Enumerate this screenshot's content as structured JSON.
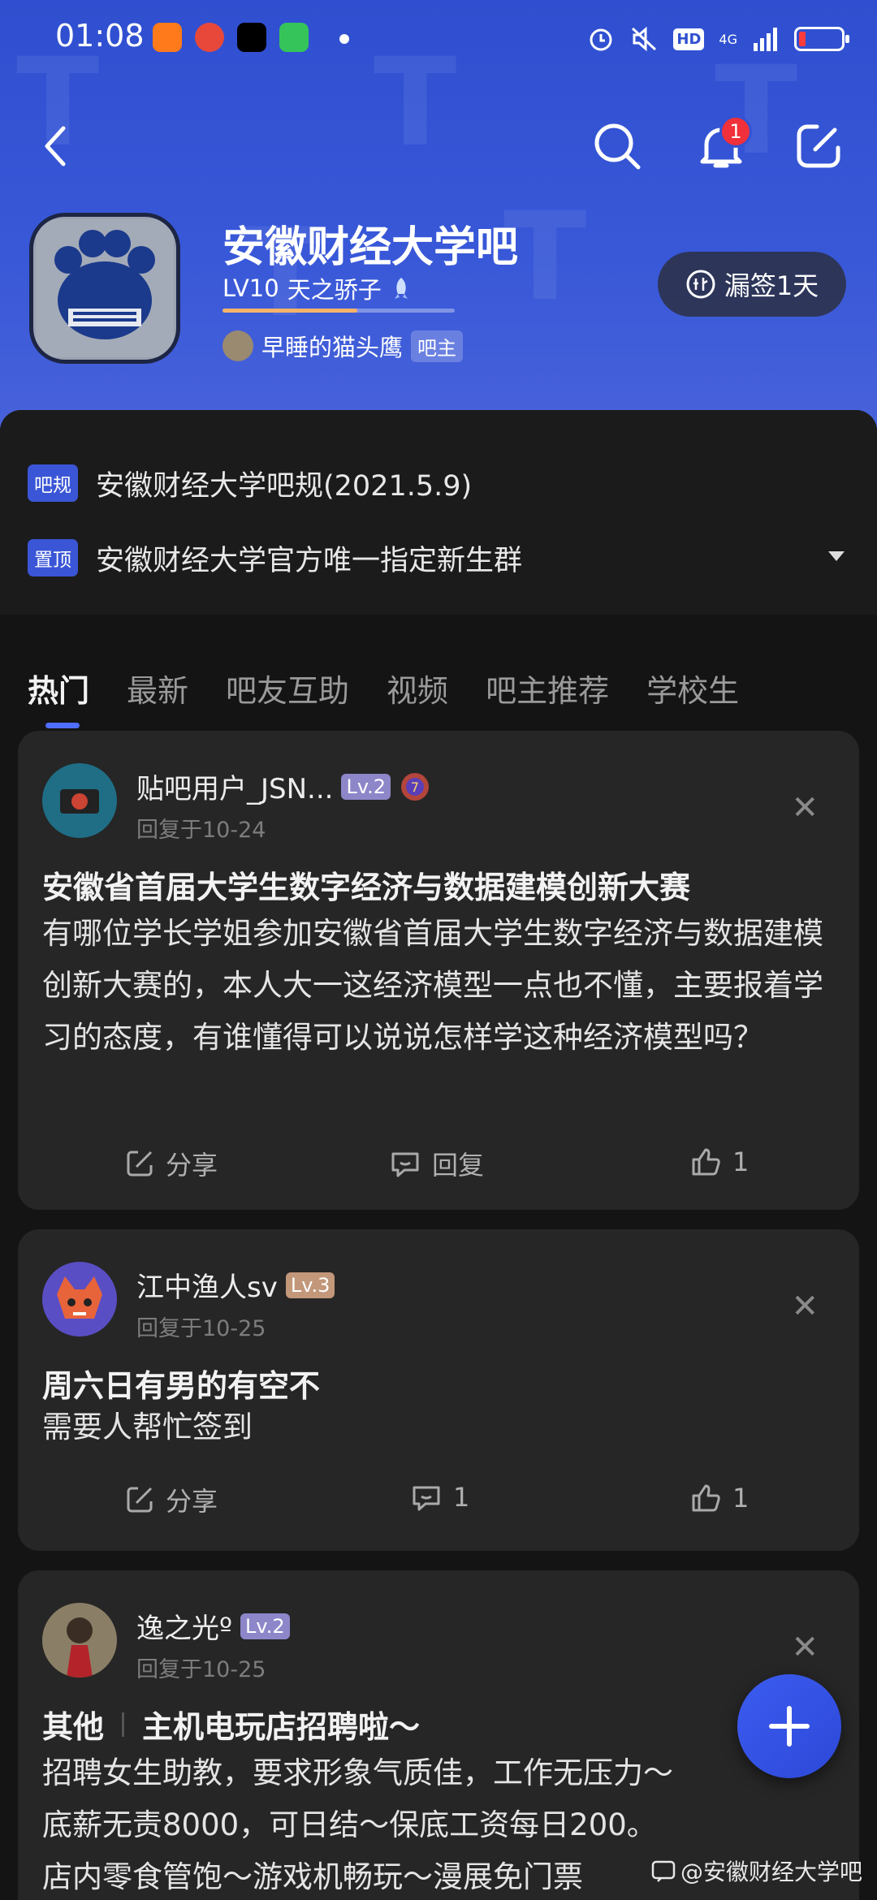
{
  "status": {
    "time": "01:08",
    "network": "4G",
    "hd": "HD"
  },
  "forum": {
    "name": "安徽财经大学吧",
    "level": "LV10",
    "level_title": "天之骄子",
    "level_progress": 0.58,
    "owner_name": "早睡的猫头鹰",
    "owner_tag": "吧主",
    "signin_label": "漏签1天",
    "notification_count": "1"
  },
  "notices": [
    {
      "tag": "吧规",
      "text": "安徽财经大学吧规(2021.5.9)"
    },
    {
      "tag": "置顶",
      "text": "安徽财经大学官方唯一指定新生群"
    }
  ],
  "tabs": [
    "热门",
    "最新",
    "吧友互助",
    "视频",
    "吧主推荐",
    "学校生"
  ],
  "posts": [
    {
      "user": "贴吧用户_JSN...",
      "level": "Lv.2",
      "time": "回复于10-24",
      "title": "安徽省首届大学生数字经济与数据建模创新大赛",
      "body": "有哪位学长学姐参加安徽省首届大学生数字经济与数据建模创新大赛的，本人大一这经济模型一点也不懂，主要报着学习的态度，有谁懂得可以说说怎样学这种经济模型吗？",
      "share": "分享",
      "reply": "回复",
      "likes": "1"
    },
    {
      "user": "江中渔人sv",
      "level": "Lv.3",
      "time": "回复于10-25",
      "title": "周六日有男的有空不",
      "body": "需要人帮忙签到",
      "share": "分享",
      "reply": "1",
      "likes": "1"
    },
    {
      "user": "逸之光º",
      "level": "Lv.2",
      "time": "回复于10-25",
      "category": "其他",
      "title": "主机电玩店招聘啦～",
      "body_lines": [
        "招聘女生助教，要求形象气质佳，工作无压力～",
        "底薪无责8000，可日结～保底工资每日200。",
        "店内零食管饱～游戏机畅玩～漫展免门票"
      ]
    }
  ],
  "watermark": "@安徽财经大学吧"
}
